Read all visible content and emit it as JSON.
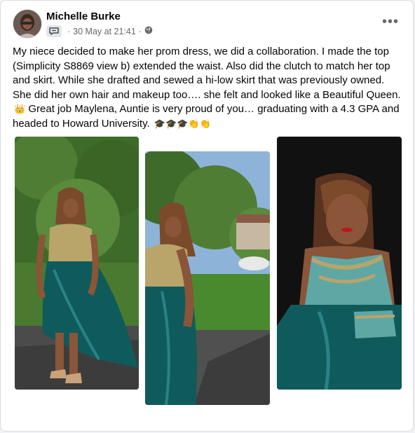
{
  "post": {
    "author": "Michelle Burke",
    "timestamp": "30 May at 21:41",
    "separator_1": "·",
    "separator_2": "·",
    "more_label": "•••",
    "body_line_1": "My niece decided to make her prom dress, we did a collaboration. I made the top (Simplicity S8869 view b) extended the waist. Also did the clutch to match her top and skirt. While she drafted and sewed a hi-low skirt that was previously owned.  She did her own hair and makeup too…. she felt and looked like a Beautiful Queen.",
    "crown_emoji": "👑",
    "body_line_2": " Great job Maylena, Auntie is very proud of you… graduating with a 4.3 GPA and headed to Howard University.",
    "trailing_emojis": "🎓🎓🎓👏👏"
  },
  "icons": {
    "group_badge": "message-badge-icon",
    "audience": "globe-icon",
    "more": "more-options-icon"
  },
  "colors": {
    "teal_dress": "#0f5b5c",
    "gold_lace": "#b9a46a",
    "name_text": "#050505",
    "meta_text": "#65676b"
  }
}
